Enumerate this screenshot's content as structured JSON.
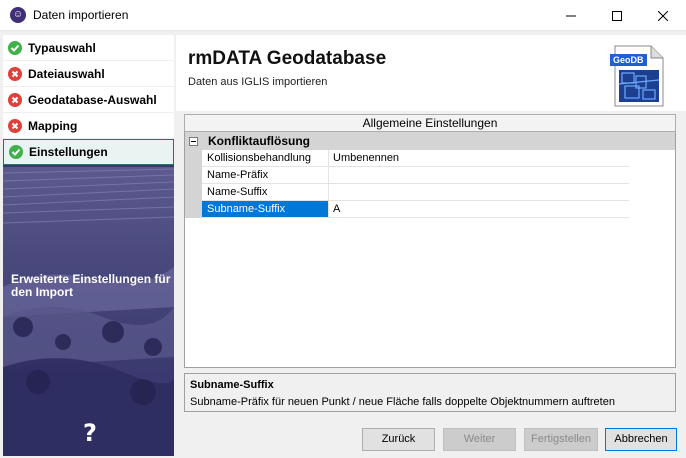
{
  "window": {
    "title": "Daten importieren",
    "app_icon": "person-icon"
  },
  "nav": {
    "items": [
      {
        "label": "Typauswahl",
        "status": "ok"
      },
      {
        "label": "Dateiauswahl",
        "status": "error"
      },
      {
        "label": "Geodatabase-Auswahl",
        "status": "error"
      },
      {
        "label": "Mapping",
        "status": "error"
      },
      {
        "label": "Einstellungen",
        "status": "ok",
        "active": true
      }
    ],
    "caption": "Erweiterte Einstellungen für den Import",
    "help_icon": "?"
  },
  "header": {
    "title": "rmDATA Geodatabase",
    "subtitle": "Daten aus IGLIS importieren",
    "logo_tag": "GeoDB"
  },
  "settings": {
    "tab_label": "Allgemeine Einstellungen",
    "category": "Konfliktauflösung",
    "properties": [
      {
        "name": "Kollisionsbehandlung",
        "value": "Umbenennen"
      },
      {
        "name": "Name-Präfix",
        "value": ""
      },
      {
        "name": "Name-Suffix",
        "value": ""
      },
      {
        "name": "Subname-Suffix",
        "value": "A",
        "selected": true
      }
    ]
  },
  "description": {
    "title": "Subname-Suffix",
    "text": "Subname-Präfix für neuen Punkt / neue Fläche falls doppelte Objektnummern auftreten"
  },
  "buttons": {
    "back": "Zurück",
    "next": "Weiter",
    "finish": "Fertigstellen",
    "cancel": "Abbrechen"
  },
  "colors": {
    "accent": "#0078d7",
    "ok": "#3fb04a",
    "error": "#e0403a",
    "nav_bg": "#3b3a6c"
  }
}
